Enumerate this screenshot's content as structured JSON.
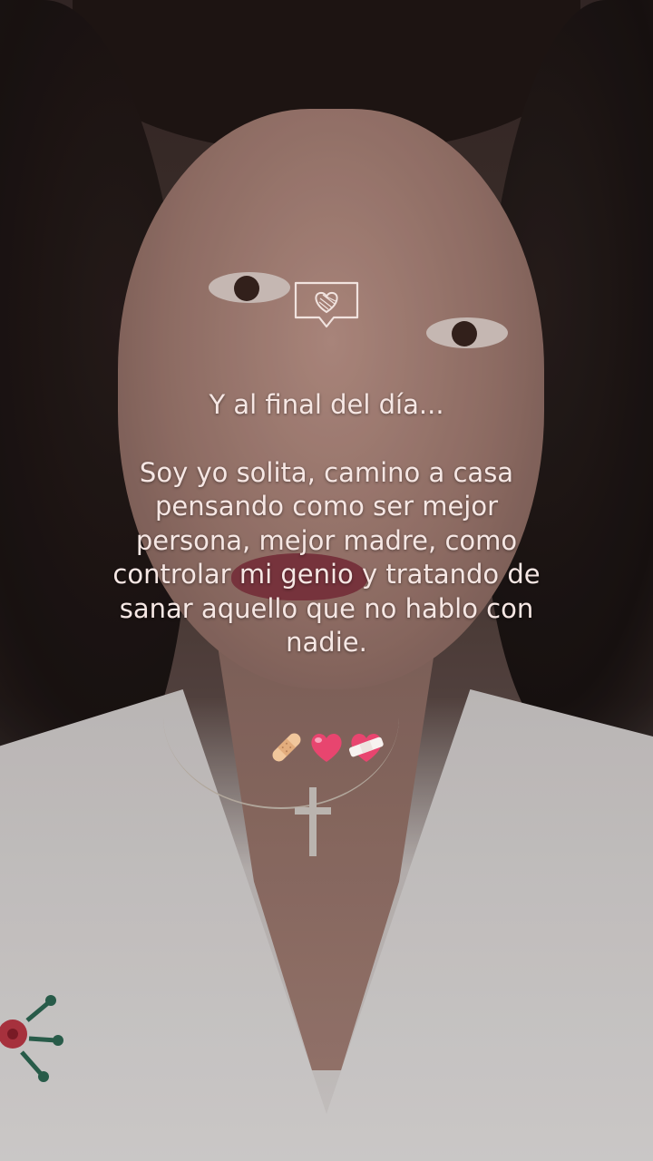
{
  "caption": {
    "line1": "Y al final del día...",
    "body": "Soy yo solita, camino a casa\npensando como ser mejor\npersona, mejor madre, como\ncontrolar mi genio y tratando de\nsanar aquello que no hablo con\nnadie."
  },
  "icons": {
    "top": "heart-speech-bubble-icon",
    "emojis": [
      "adhesive-bandage-icon",
      "pink-heart-icon",
      "mending-heart-icon"
    ]
  },
  "colors": {
    "caption_text": "#f6e7e4",
    "heart_pink": "#e8456f"
  }
}
